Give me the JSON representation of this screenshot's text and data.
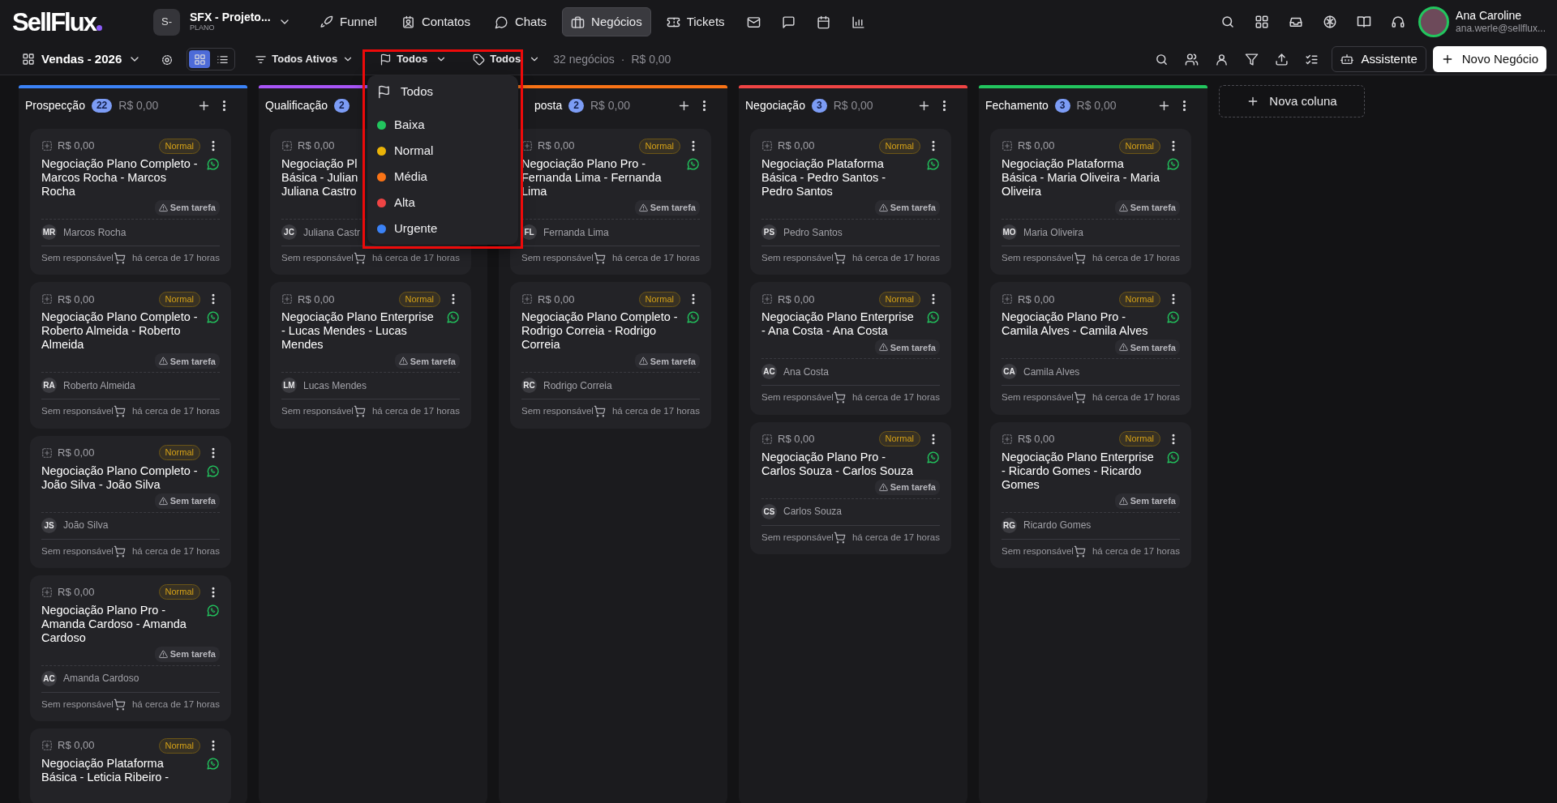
{
  "topbar": {
    "logo": "SellFlux",
    "workspace": {
      "avatar": "S-",
      "name": "SFX - Projeto...",
      "plan": "PLANO"
    },
    "nav": [
      {
        "label": "Funnel",
        "selected": false
      },
      {
        "label": "Contatos",
        "selected": false
      },
      {
        "label": "Chats",
        "selected": false
      },
      {
        "label": "Negócios",
        "selected": true
      },
      {
        "label": "Tickets",
        "selected": false
      }
    ],
    "user": {
      "name": "Ana Caroline",
      "email": "ana.werle@sellflux..."
    }
  },
  "toolbar": {
    "pipeline": "Vendas - 2026",
    "views": [
      {
        "kind": "kanban",
        "selected": true
      },
      {
        "kind": "list",
        "selected": false
      }
    ],
    "status_filter": "Todos Ativos",
    "priority_filter": "Todos",
    "tag_filter": "Todos",
    "deal_count": "32 negócios",
    "separator": "·",
    "total": "R$ 0,00",
    "assistant_button": "Assistente",
    "new_button": "Novo Negócio"
  },
  "priority_menu": {
    "open": true,
    "items": [
      {
        "label": "Todos",
        "kind": "all"
      },
      {
        "label": "Baixa",
        "kind": "level",
        "color": "#22c55e"
      },
      {
        "label": "Normal",
        "kind": "level",
        "color": "#eab308"
      },
      {
        "label": "Média",
        "kind": "level",
        "color": "#f97316"
      },
      {
        "label": "Alta",
        "kind": "level",
        "color": "#ef4444"
      },
      {
        "label": "Urgente",
        "kind": "level",
        "color": "#3b82f6"
      }
    ]
  },
  "columns": [
    {
      "title": "Prospecção",
      "count": "22",
      "total": "R$ 0,00",
      "color": "#3b82f6",
      "cards": [
        {
          "amount": "R$ 0,00",
          "priority": "Normal",
          "title": "Negociação Plano Completo - Marcos Rocha - Marcos Rocha",
          "task": "Sem tarefa",
          "initials": "MR",
          "contact": "Marcos Rocha",
          "owner": "Sem responsável",
          "time": "há cerca de 17 horas"
        },
        {
          "amount": "R$ 0,00",
          "priority": "Normal",
          "title": "Negociação Plano Completo - Roberto Almeida - Roberto Almeida",
          "task": "Sem tarefa",
          "initials": "RA",
          "contact": "Roberto Almeida",
          "owner": "Sem responsável",
          "time": "há cerca de 17 horas"
        },
        {
          "amount": "R$ 0,00",
          "priority": "Normal",
          "title": "Negociação Plano Completo - João Silva - João Silva",
          "task": "Sem tarefa",
          "initials": "JS",
          "contact": "João Silva",
          "owner": "Sem responsável",
          "time": "há cerca de 17 horas"
        },
        {
          "amount": "R$ 0,00",
          "priority": "Normal",
          "title": "Negociação Plano Pro - Amanda Cardoso - Amanda Cardoso",
          "task": "Sem tarefa",
          "initials": "AC",
          "contact": "Amanda Cardoso",
          "owner": "Sem responsável",
          "time": "há cerca de 17 horas"
        },
        {
          "amount": "R$ 0,00",
          "priority": "Normal",
          "title": "Negociação Plataforma Básica - Leticia Ribeiro -"
        }
      ]
    },
    {
      "title": "Qualificação",
      "count": "2",
      "color": "#a855f7",
      "cards": [
        {
          "amount": "R$ 0,00",
          "title": "Negociação Pl\nBásica - Julian\nJuliana Castro",
          "initials": "JC",
          "contact": "Juliana Castr",
          "owner": "Sem responsável",
          "time": "há cerca de 17 horas"
        },
        {
          "amount": "R$ 0,00",
          "priority": "Normal",
          "title": "Negociação Plano Enterprise - Lucas Mendes - Lucas Mendes",
          "task": "Sem tarefa",
          "initials": "LM",
          "contact": "Lucas Mendes",
          "owner": "Sem responsável",
          "time": "há cerca de 17 horas"
        }
      ]
    },
    {
      "title": "posta",
      "title_clipped": true,
      "count": "2",
      "total": "R$ 0,00",
      "color": "#f97316",
      "cards": [
        {
          "amount": "R$ 0,00",
          "priority": "Normal",
          "title": "Negociação Plano Pro - Fernanda Lima - Fernanda Lima",
          "task": "Sem tarefa",
          "initials": "FL",
          "contact": "Fernanda Lima",
          "owner": "Sem responsável",
          "time": "há cerca de 17 horas"
        },
        {
          "amount": "R$ 0,00",
          "priority": "Normal",
          "title": "Negociação Plano Completo - Rodrigo Correia - Rodrigo Correia",
          "task": "Sem tarefa",
          "initials": "RC",
          "contact": "Rodrigo Correia",
          "owner": "Sem responsável",
          "time": "há cerca de 17 horas"
        }
      ]
    },
    {
      "title": "Negociação",
      "count": "3",
      "total": "R$ 0,00",
      "color": "#ef4444",
      "cards": [
        {
          "amount": "R$ 0,00",
          "priority": "Normal",
          "title": "Negociação Plataforma Básica - Pedro Santos - Pedro Santos",
          "task": "Sem tarefa",
          "initials": "PS",
          "contact": "Pedro Santos",
          "owner": "Sem responsável",
          "time": "há cerca de 17 horas"
        },
        {
          "amount": "R$ 0,00",
          "priority": "Normal",
          "title": "Negociação Plano Enterprise - Ana Costa - Ana Costa",
          "task": "Sem tarefa",
          "initials": "AC",
          "contact": "Ana Costa",
          "owner": "Sem responsável",
          "time": "há cerca de 17 horas"
        },
        {
          "amount": "R$ 0,00",
          "priority": "Normal",
          "title": "Negociação Plano Pro - Carlos Souza - Carlos Souza",
          "task": "Sem tarefa",
          "initials": "CS",
          "contact": "Carlos Souza",
          "owner": "Sem responsável",
          "time": "há cerca de 17 horas"
        }
      ]
    },
    {
      "title": "Fechamento",
      "count": "3",
      "total": "R$ 0,00",
      "color": "#22c55e",
      "cards": [
        {
          "amount": "R$ 0,00",
          "priority": "Normal",
          "title": "Negociação Plataforma Básica - Maria Oliveira - Maria Oliveira",
          "task": "Sem tarefa",
          "initials": "MO",
          "contact": "Maria Oliveira",
          "owner": "Sem responsável",
          "time": "há cerca de 17 horas"
        },
        {
          "amount": "R$ 0,00",
          "priority": "Normal",
          "title": "Negociação Plano Pro - Camila Alves - Camila Alves",
          "task": "Sem tarefa",
          "initials": "CA",
          "contact": "Camila Alves",
          "owner": "Sem responsável",
          "time": "há cerca de 17 horas"
        },
        {
          "amount": "R$ 0,00",
          "priority": "Normal",
          "title": "Negociação Plano Enterprise - Ricardo Gomes - Ricardo Gomes",
          "task": "Sem tarefa",
          "initials": "RG",
          "contact": "Ricardo Gomes",
          "owner": "Sem responsável",
          "time": "há cerca de 17 horas"
        }
      ]
    }
  ],
  "add_column": "Nova coluna"
}
